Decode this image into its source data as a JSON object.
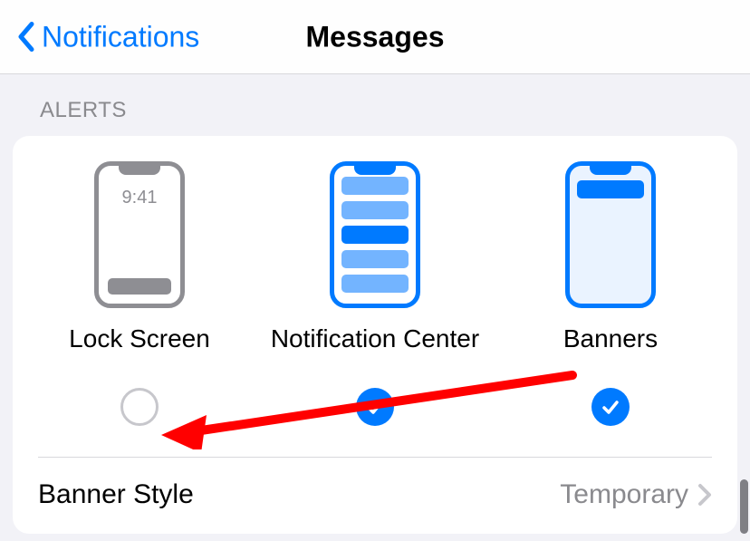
{
  "nav": {
    "back_label": "Notifications",
    "title": "Messages"
  },
  "section_header": "Alerts",
  "options": {
    "lock_screen": {
      "label": "Lock Screen",
      "checked": false
    },
    "notification_center": {
      "label": "Notification Center",
      "checked": true
    },
    "banners": {
      "label": "Banners",
      "checked": true
    }
  },
  "lock_time": "9:41",
  "banner_style": {
    "label": "Banner Style",
    "value": "Temporary"
  }
}
